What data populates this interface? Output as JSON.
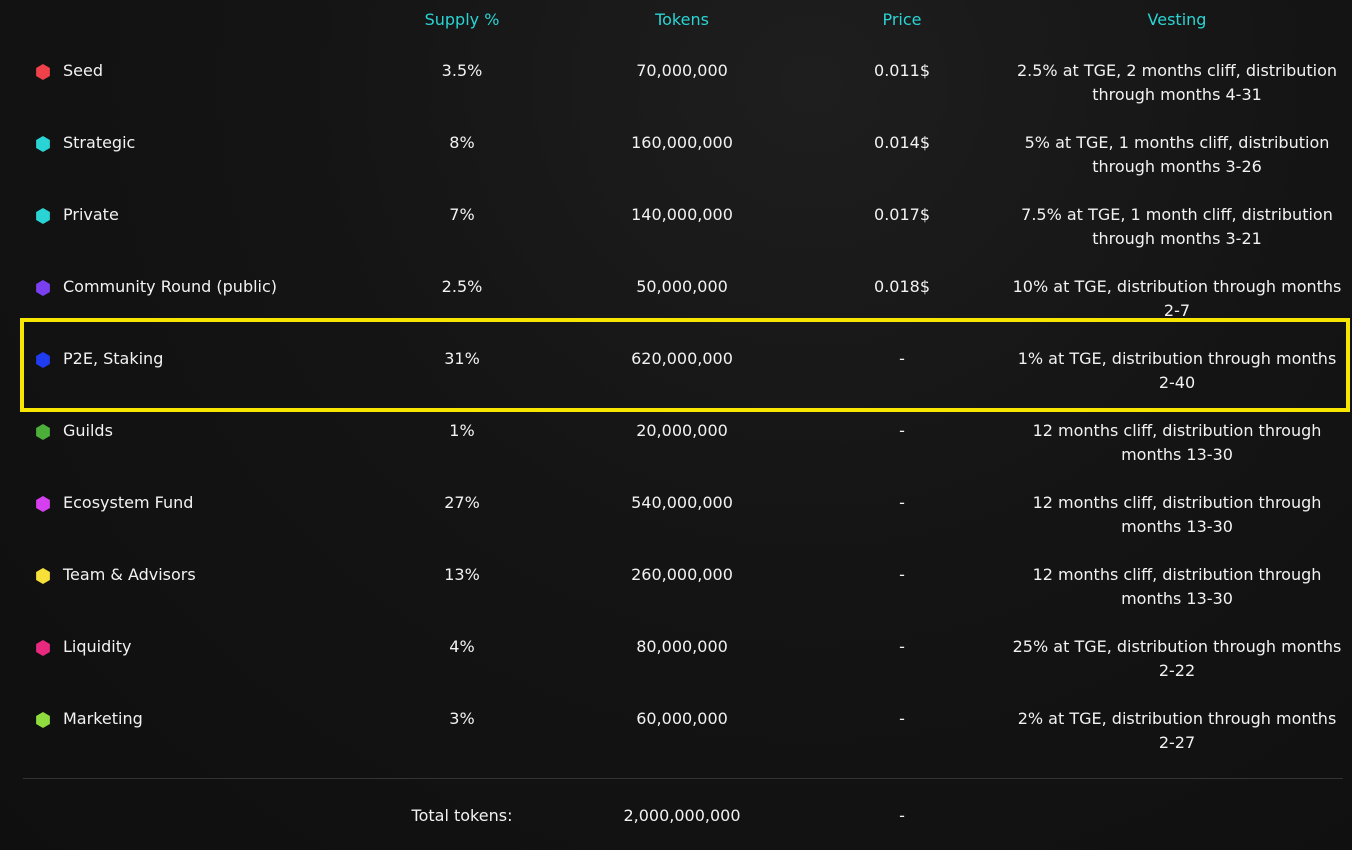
{
  "headers": {
    "supply": "Supply %",
    "tokens": "Tokens",
    "price": "Price",
    "vesting": "Vesting"
  },
  "rows": [
    {
      "name": "Seed",
      "supply": "3.5%",
      "tokens": "70,000,000",
      "price": "0.011$",
      "vesting": "2.5% at TGE, 2 months cliff, distribution through months 4-31",
      "color": "#f0414a"
    },
    {
      "name": "Strategic",
      "supply": "8%",
      "tokens": "160,000,000",
      "price": "0.014$",
      "vesting": "5% at TGE, 1 months cliff, distribution through months 3-26",
      "color": "#2ad4d4"
    },
    {
      "name": "Private",
      "supply": "7%",
      "tokens": "140,000,000",
      "price": "0.017$",
      "vesting": "7.5% at TGE, 1 month cliff, distribution through months 3-21",
      "color": "#2ad4d4"
    },
    {
      "name": "Community Round (public)",
      "supply": "2.5%",
      "tokens": "50,000,000",
      "price": "0.018$",
      "vesting": "10% at TGE, distribution through months 2-7",
      "color": "#7b3ff2"
    },
    {
      "name": "P2E, Staking",
      "supply": "31%",
      "tokens": "620,000,000",
      "price": "-",
      "vesting": "1% at TGE, distribution through months 2-40",
      "color": "#1f3cf0"
    },
    {
      "name": "Guilds",
      "supply": "1%",
      "tokens": "20,000,000",
      "price": "-",
      "vesting": "12 months cliff, distribution through months 13-30",
      "color": "#4caf3a"
    },
    {
      "name": "Ecosystem Fund",
      "supply": "27%",
      "tokens": "540,000,000",
      "price": "-",
      "vesting": "12 months cliff, distribution through months 13-30",
      "color": "#d63ff0"
    },
    {
      "name": "Team & Advisors",
      "supply": "13%",
      "tokens": "260,000,000",
      "price": "-",
      "vesting": "12 months cliff, distribution through months 13-30",
      "color": "#f7e03a"
    },
    {
      "name": "Liquidity",
      "supply": "4%",
      "tokens": "80,000,000",
      "price": "-",
      "vesting": "25% at TGE, distribution through months 2-22",
      "color": "#e8297f"
    },
    {
      "name": "Marketing",
      "supply": "3%",
      "tokens": "60,000,000",
      "price": "-",
      "vesting": "2% at TGE, distribution through months 2-27",
      "color": "#8fdc3f"
    }
  ],
  "total": {
    "label": "Total tokens:",
    "tokens": "2,000,000,000",
    "price": "-"
  },
  "colors": {
    "accent": "#2ad4d4",
    "highlight": "#f7e600",
    "background": "#121212"
  }
}
